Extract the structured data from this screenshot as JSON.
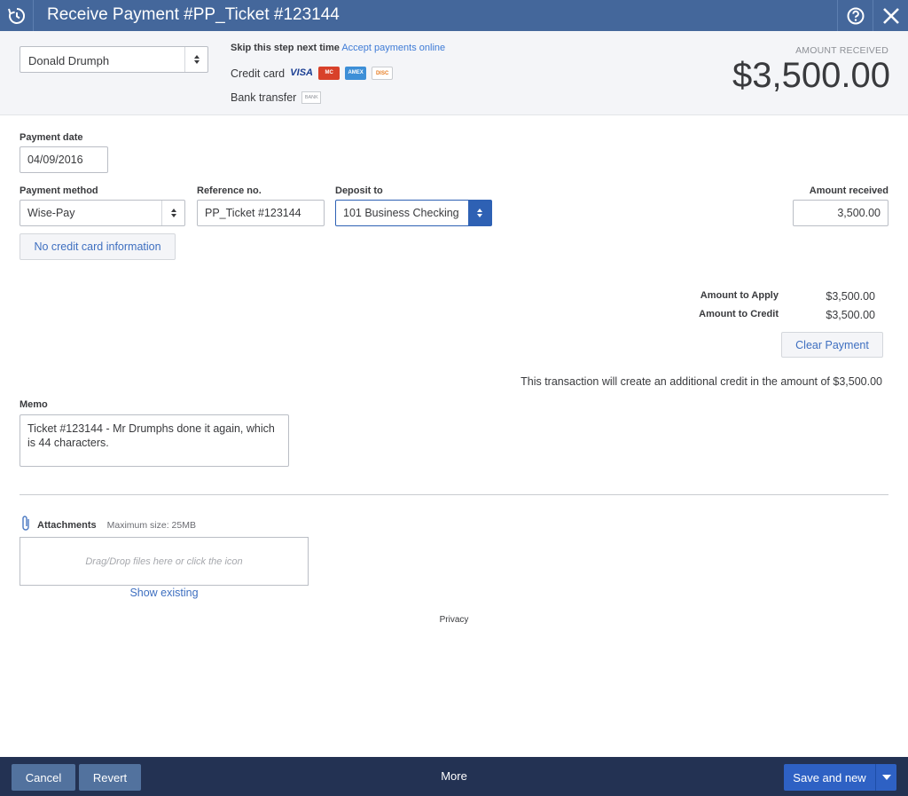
{
  "window": {
    "title": "Receive Payment #PP_Ticket #123144",
    "icons": {
      "history": "history-icon",
      "help": "help-icon",
      "close": "close-icon"
    }
  },
  "header": {
    "customer": "Donald Drumph",
    "skip_text": "Skip this step next time",
    "accept_link": "Accept payments online",
    "credit_card_label": "Credit card",
    "card_brands": [
      "VISA",
      "MC",
      "AMEX",
      "DISC"
    ],
    "bank_transfer_label": "Bank transfer",
    "bank_badge": "BANK",
    "amount_received_label": "AMOUNT RECEIVED",
    "amount_received": "$3,500.00"
  },
  "form": {
    "payment_date_label": "Payment date",
    "payment_date": "04/09/2016",
    "payment_method_label": "Payment method",
    "payment_method": "Wise-Pay",
    "reference_label": "Reference no.",
    "reference": "PP_Ticket #123144",
    "deposit_label": "Deposit to",
    "deposit": "101 Business Checking",
    "amount_received_label": "Amount received",
    "amount_received": "3,500.00",
    "no_cc_button": "No credit card information"
  },
  "summary": {
    "apply_label": "Amount to Apply",
    "apply_value": "$3,500.00",
    "credit_label": "Amount to Credit",
    "credit_value": "$3,500.00",
    "clear_button": "Clear Payment",
    "note": "This transaction will create an additional credit in the amount of $3,500.00"
  },
  "memo": {
    "label": "Memo",
    "text": "Ticket #123144 - Mr Drumphs done it again, which is 44 characters."
  },
  "attachments": {
    "label": "Attachments",
    "max_size": "Maximum size: 25MB",
    "dropzone": "Drag/Drop files here or click the icon",
    "show_existing": "Show existing"
  },
  "footer": {
    "privacy": "Privacy",
    "cancel": "Cancel",
    "revert": "Revert",
    "more": "More",
    "save_new": "Save and new"
  }
}
